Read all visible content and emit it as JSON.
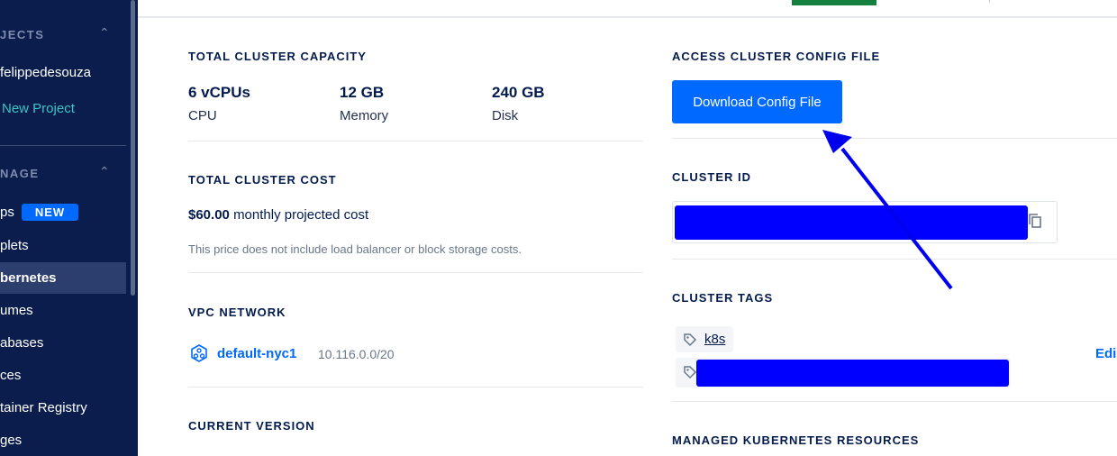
{
  "sidebar": {
    "projects_section": "JECTS",
    "project_user": "felippedesouza",
    "new_project": "New Project",
    "manage_section": "NAGE",
    "items": [
      {
        "label": "ps",
        "badge": "NEW"
      },
      {
        "label": "plets"
      },
      {
        "label": "bernetes"
      },
      {
        "label": "umes"
      },
      {
        "label": "abases"
      },
      {
        "label": "ces"
      },
      {
        "label": "tainer Registry"
      },
      {
        "label": "ges"
      }
    ]
  },
  "capacity": {
    "title": "TOTAL CLUSTER CAPACITY",
    "cpu_value": "6 vCPUs",
    "cpu_label": "CPU",
    "memory_value": "12 GB",
    "memory_label": "Memory",
    "disk_value": "240 GB",
    "disk_label": "Disk"
  },
  "cost": {
    "title": "TOTAL CLUSTER COST",
    "amount": "$60.00",
    "amount_suffix": "monthly projected cost",
    "note": "This price does not include load balancer or block storage costs."
  },
  "vpc": {
    "title": "VPC NETWORK",
    "name": "default-nyc1",
    "range": "10.116.0.0/20"
  },
  "version": {
    "title": "CURRENT VERSION"
  },
  "config": {
    "title": "ACCESS CLUSTER CONFIG FILE",
    "button": "Download Config File"
  },
  "cluster_id": {
    "title": "CLUSTER ID"
  },
  "tags": {
    "title": "CLUSTER TAGS",
    "items": [
      "k8s"
    ],
    "edit": "Edi"
  },
  "resources": {
    "title": "MANAGED KUBERNETES RESOURCES"
  },
  "colors": {
    "accent": "#0069ff",
    "sidebar_bg": "#0b1d4d",
    "redaction": "#0000ff",
    "arrow": "#0000ee"
  }
}
